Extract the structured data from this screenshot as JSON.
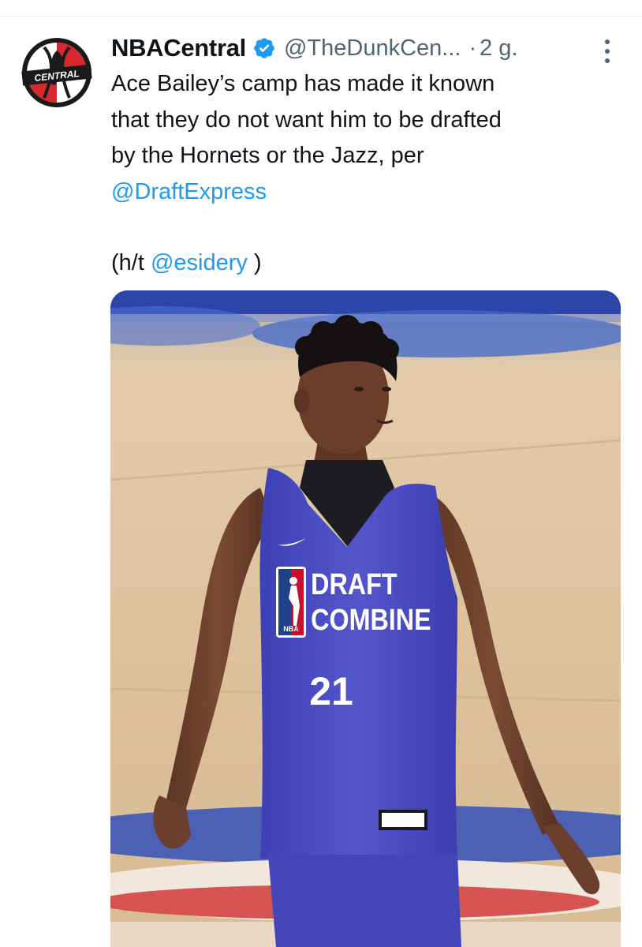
{
  "tweet": {
    "display_name": "NBACentral",
    "handle": "@TheDunkCen...",
    "separator": "·",
    "timestamp": "2 g.",
    "avatar_text": "CENTRAL",
    "line1": "Ace Bailey’s camp has made it known",
    "line2": "that they do not want him to be drafted",
    "line3": "by the Hornets or the Jazz, per",
    "mention1": "@DraftExpress",
    "ht_prefix": "(h/t ",
    "mention2": "@esidery",
    "ht_suffix": " )"
  },
  "media": {
    "jersey_line1": "DRAFT",
    "jersey_line2": "COMBINE",
    "jersey_number": "21",
    "logo_text": "NBA"
  },
  "colors": {
    "link": "#1d9bf0",
    "secondary_text": "#536471",
    "verified": "#1d9bf0",
    "jersey": "#4f52c8"
  },
  "icons": {
    "verified": "verified-badge-icon",
    "more": "more-options-icon"
  }
}
